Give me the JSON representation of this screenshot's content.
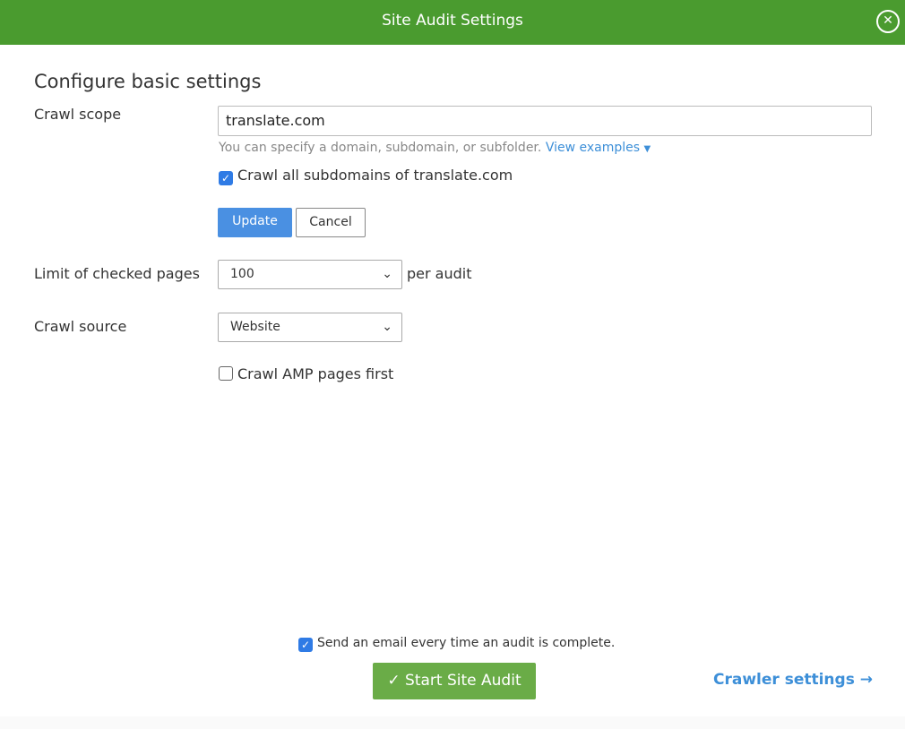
{
  "header": {
    "title": "Site Audit Settings",
    "close_icon": "close-circle-icon"
  },
  "main": {
    "heading": "Configure basic settings",
    "crawl_scope": {
      "label": "Crawl scope",
      "value": "translate.com",
      "hint": "You can specify a domain, subdomain, or subfolder.",
      "hint_link": "View examples",
      "subdomains_checkbox": {
        "label": "Crawl all subdomains of translate.com",
        "checked": true
      },
      "update": "Update",
      "cancel": "Cancel"
    },
    "limit": {
      "label": "Limit of checked pages",
      "value": "100",
      "suffix": "per audit"
    },
    "source": {
      "label": "Crawl source",
      "value": "Website"
    },
    "amp_checkbox": {
      "label": "Crawl AMP pages first",
      "checked": false
    }
  },
  "footer": {
    "email_checkbox": {
      "label": "Send an email every time an audit is complete.",
      "checked": true
    },
    "start": "Start Site Audit",
    "crawler_settings": "Crawler settings"
  },
  "colors": {
    "header": "#4a9b2f",
    "primary_button": "#4a90e2",
    "start_button": "#6aac47",
    "link": "#3d8fd8"
  }
}
